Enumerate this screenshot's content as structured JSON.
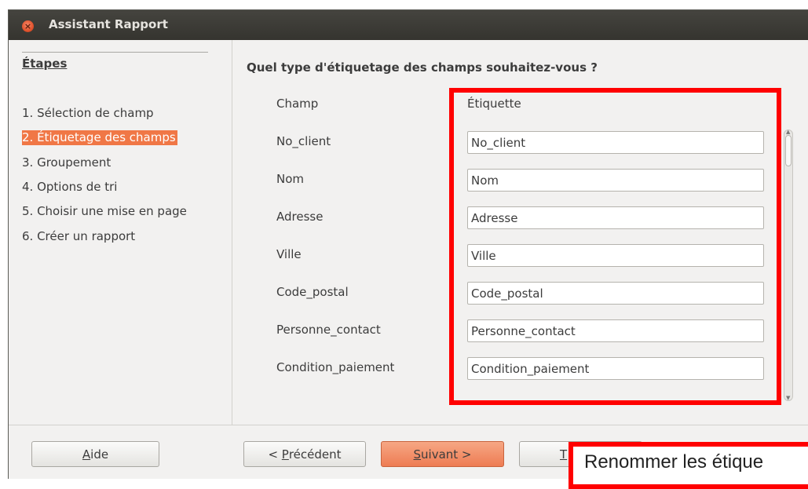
{
  "window": {
    "title": "Assistant Rapport",
    "close_icon": "×"
  },
  "sidebar": {
    "header": "Étapes",
    "steps": [
      "1. Sélection de champ",
      "2. Étiquetage des champs",
      "3. Groupement",
      "4. Options de tri",
      "5. Choisir une mise en page",
      "6. Créer un rapport"
    ],
    "active_step_index": 1
  },
  "main": {
    "question": "Quel type d'étiquetage des champs souhaitez-vous ?",
    "col_field": "Champ",
    "col_label": "Étiquette",
    "rows": [
      {
        "field": "No_client",
        "label": "No_client"
      },
      {
        "field": "Nom",
        "label": "Nom"
      },
      {
        "field": "Adresse",
        "label": "Adresse"
      },
      {
        "field": "Ville",
        "label": "Ville"
      },
      {
        "field": "Code_postal",
        "label": "Code_postal"
      },
      {
        "field": "Personne_contact",
        "label": "Personne_contact"
      },
      {
        "field": "Condition_paiement",
        "label": "Condition_paiement"
      }
    ]
  },
  "footer": {
    "help_mnemonic": "A",
    "help_rest": "ide",
    "prev_prefix": "< ",
    "prev_mnemonic": "P",
    "prev_rest": "récédent",
    "next_mnemonic": "S",
    "next_rest": "uivant >",
    "finish_partial": "T"
  },
  "annotation": {
    "callout_text": "Renommer les étique"
  },
  "colors": {
    "highlight": "#ff0000",
    "active_step": "#f07746",
    "primary_button": "#ee7c53"
  }
}
